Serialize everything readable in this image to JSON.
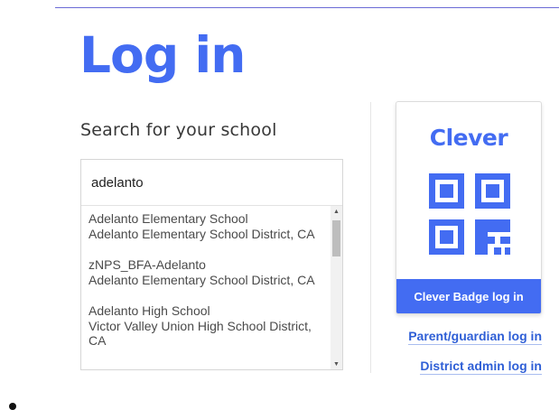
{
  "header": {
    "title": "Log in"
  },
  "search": {
    "label": "Search for your school",
    "value": "adelanto",
    "results": [
      {
        "name": "Adelanto Elementary School",
        "district": "Adelanto Elementary School District, CA"
      },
      {
        "name": "zNPS_BFA-Adelanto",
        "district": "Adelanto Elementary School District, CA"
      },
      {
        "name": "Adelanto High School",
        "district": "Victor Valley Union High School District, CA"
      }
    ]
  },
  "badge": {
    "logo_text": "Clever",
    "button_label": "Clever Badge log in"
  },
  "links": {
    "parent": "Parent/guardian log in",
    "district": "District admin log in"
  },
  "colors": {
    "brand": "#436cf2",
    "link": "#2f5fd6"
  }
}
